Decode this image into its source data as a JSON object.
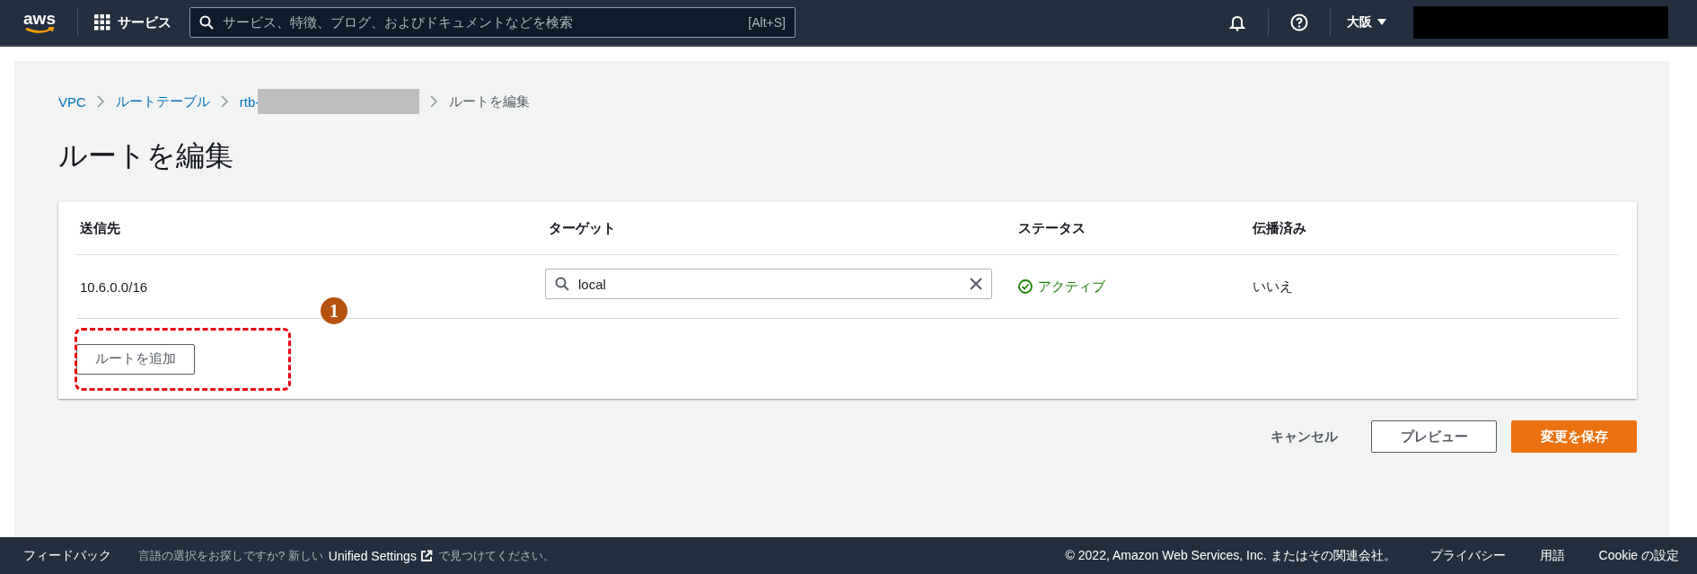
{
  "top_bar": {
    "logo": "aws",
    "services": "サービス",
    "search": {
      "placeholder": "サービス、特徴、ブログ、およびドキュメントなどを検索",
      "shortcut": "[Alt+S]"
    },
    "region": "大阪",
    "account_redacted": true
  },
  "breadcrumb": [
    {
      "label": "VPC",
      "kind": "link"
    },
    {
      "label": "ルートテーブル",
      "kind": "link"
    },
    {
      "label": "rtb-",
      "kind": "redacted"
    },
    {
      "label": "ルートを編集",
      "kind": "current"
    }
  ],
  "title": "ルートを編集",
  "table": {
    "columns": [
      "送信先",
      "ターゲット",
      "ステータス",
      "伝播済み"
    ],
    "rows": [
      {
        "destination": "10.6.0.0/16",
        "target": "local",
        "status": "アクティブ",
        "propagated": "いいえ"
      }
    ],
    "add_button": "ルートを追加"
  },
  "annotation": {
    "number": "1"
  },
  "actions": {
    "cancel": "キャンセル",
    "preview": "プレビュー",
    "save": "変更を保存"
  },
  "footer": {
    "feedback": "フィードバック",
    "lang_prompt": "言語の選択をお探しですか? 新しい",
    "unified": "Unified Settings",
    "lang_suffix": "で見つけてください。",
    "copyright": "© 2022, Amazon Web Services, Inc. またはその関連会社。",
    "links": [
      "プライバシー",
      "用語",
      "Cookie の設定"
    ]
  }
}
